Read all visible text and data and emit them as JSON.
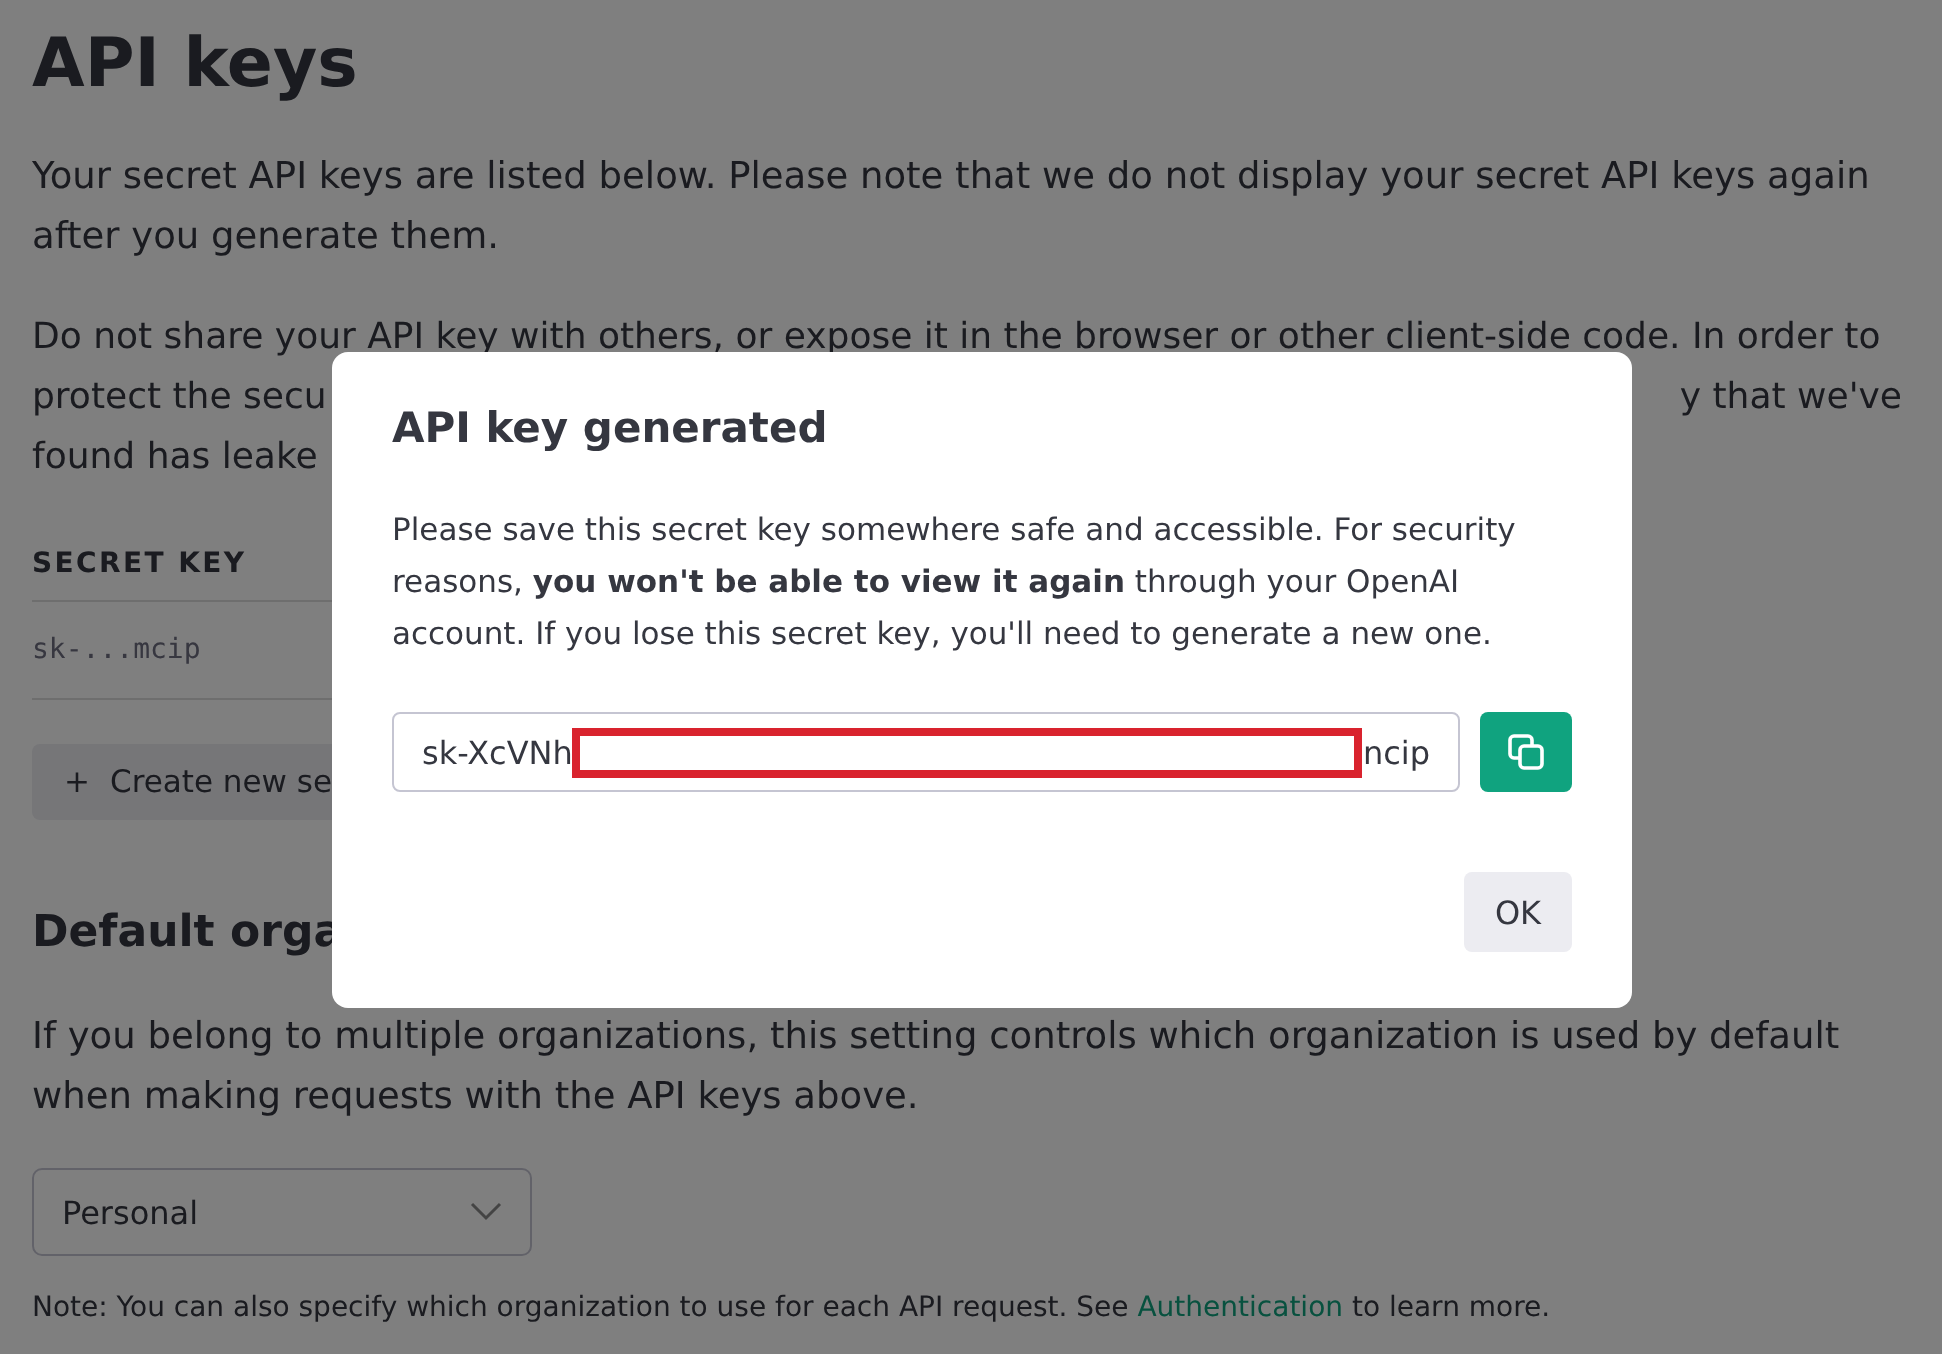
{
  "page": {
    "title": "API keys",
    "intro": "Your secret API keys are listed below. Please note that we do not display your secret API keys again after you generate them.",
    "warning_lines": [
      {
        "left": "Do not share your API key with others, or expose it in the browser or other client-side code. In order to"
      },
      {
        "left": "protect the secu",
        "right": "y that we've"
      },
      {
        "left": "found has leake"
      }
    ],
    "table": {
      "columns": [
        "SECRET KEY"
      ],
      "rows": [
        [
          "sk-...mcip"
        ]
      ]
    },
    "create_button": {
      "icon": "+",
      "label": "Create new se"
    },
    "org_heading": "Default orga",
    "org_text": "If you belong to multiple organizations, this setting controls which organization is used by default when making requests with the API keys above.",
    "org_select": {
      "value": "Personal"
    },
    "note": {
      "before": "Note: You can also specify which organization to use for each API request. See ",
      "link": "Authentication",
      "after": " to learn more."
    }
  },
  "dialog": {
    "title": "API key generated",
    "text": "Please save this secret key somewhere safe and accessible. For security reasons, **you won't be able to view it again** through your OpenAI account. If you lose this secret key, you'll need to generate a new one.",
    "key_start": "sk-XcVNh",
    "key_end": "ncip",
    "redacted": true,
    "ok": "OK"
  }
}
